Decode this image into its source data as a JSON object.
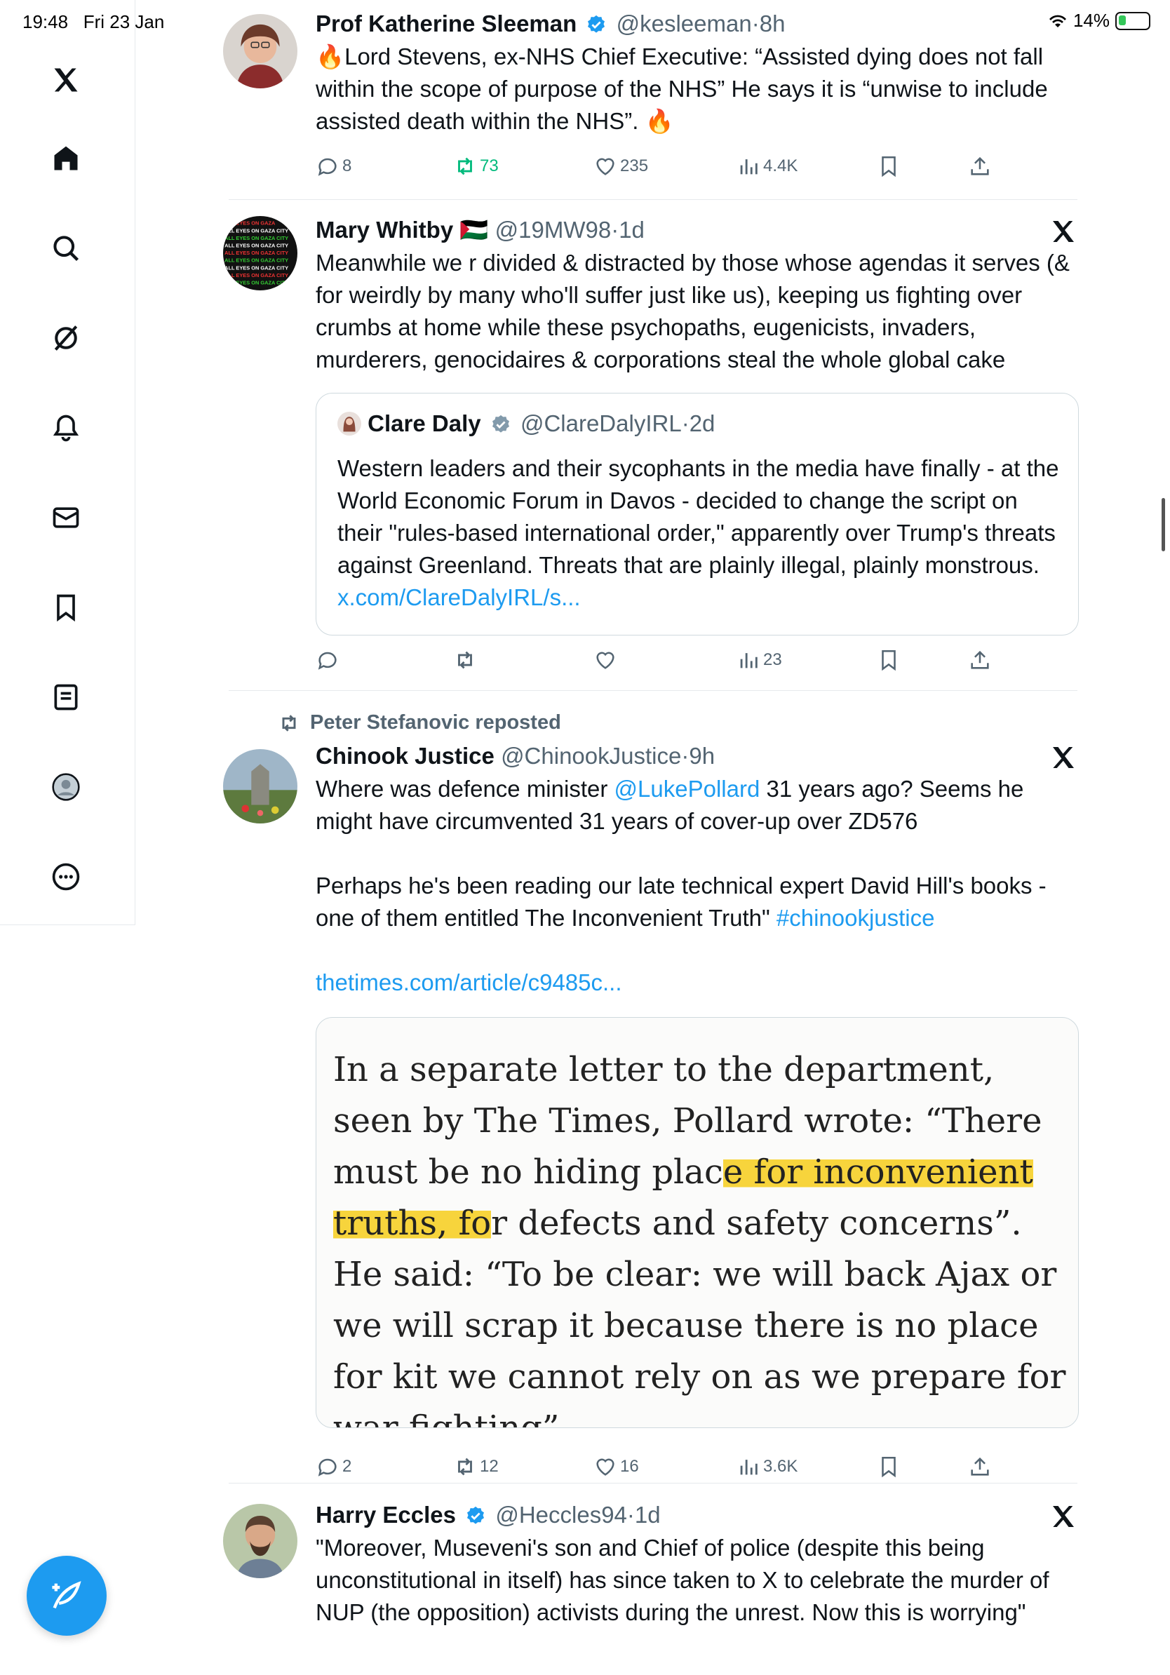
{
  "status_bar": {
    "time": "19:48",
    "date": "Fri 23 Jan",
    "battery": "14%"
  },
  "colors": {
    "accent": "#1d9bf0",
    "retweet_green": "#00ba7c",
    "muted": "#536471",
    "highlight": "#f7d43c"
  },
  "sidebar": {
    "items": [
      {
        "icon": "x-logo-icon"
      },
      {
        "icon": "home-icon"
      },
      {
        "icon": "search-icon"
      },
      {
        "icon": "grok-icon"
      },
      {
        "icon": "notifications-bell-icon"
      },
      {
        "icon": "messages-envelope-icon"
      },
      {
        "icon": "bookmarks-icon"
      },
      {
        "icon": "lists-icon"
      },
      {
        "icon": "profile-avatar-icon"
      },
      {
        "icon": "more-circle-icon"
      }
    ],
    "compose_icon": "compose-feather-icon"
  },
  "tweets": [
    {
      "name": "Prof Katherine Sleeman",
      "handle": "@kesleeman",
      "sep": "·",
      "time": "8h",
      "text": "🔥Lord Stevens, ex-NHS Chief Executive: “Assisted dying does not fall within the scope of purpose of the NHS” He says it is “unwise to include assisted death within the NHS”. 🔥",
      "replies": "8",
      "retweets": "73",
      "likes": "235",
      "views": "4.4K"
    },
    {
      "name": "Mary Whitby",
      "flag": "🇵🇸",
      "handle": "@19MW98",
      "sep": "·",
      "time": "1d",
      "text": "Meanwhile we r divided & distracted by those whose agendas it serves (& for weirdly by many who'll suffer just like us), keeping us fighting over crumbs at home while these psychopaths, eugenicists, invaders, murderers, genocidaires & corporations steal the whole global cake",
      "quote": {
        "name": "Clare Daly",
        "handle": "@ClareDalyIRL",
        "sep": "·",
        "time": "2d",
        "text": "Western leaders and their sycophants in the media have finally - at the World Economic Forum in Davos - decided to change the script on their \"rules-based international order,\" apparently over Trump's threats against Greenland. Threats that are plainly illegal, plainly monstrous. ",
        "link": "x.com/ClareDalyIRL/s..."
      },
      "replies": "",
      "retweets": "",
      "likes": "",
      "views": "23"
    },
    {
      "repost_by": "Peter Stefanovic reposted",
      "name": "Chinook Justice",
      "handle": "@ChinookJustice",
      "sep": "·",
      "time": "9h",
      "text_a": "Where was defence minister ",
      "mention": "@LukePollard",
      "text_b": " 31 years ago? Seems he might have circumvented 31 years of cover-up over ZD576\n\nPerhaps he's been reading our late technical expert David Hill's books - one of them entitled The Inconvenient Truth\" ",
      "hashtag": "#chinookjustice",
      "url": "thetimes.com/article/c9485c...",
      "article": {
        "before": "In a separate letter to the department, seen by The Times, Pollard wrote: “There must be no hiding plac",
        "highlight": "e for inconvenient truths, fo",
        "after": "r defects and safety concerns”. He said: “To be clear: we will back Ajax or we will scrap it because there is no place for kit we cannot rely on as we prepare for war fighting”."
      },
      "replies": "2",
      "retweets": "12",
      "likes": "16",
      "views": "3.6K"
    },
    {
      "name": "Harry Eccles",
      "handle": "@Heccles94",
      "sep": "·",
      "time": "1d",
      "text": "\"Moreover, Museveni's son and Chief of police (despite this being unconstitutional in itself) has since taken to X to celebrate the murder of NUP (the opposition) activists during the unrest. Now this is worrying\""
    }
  ]
}
